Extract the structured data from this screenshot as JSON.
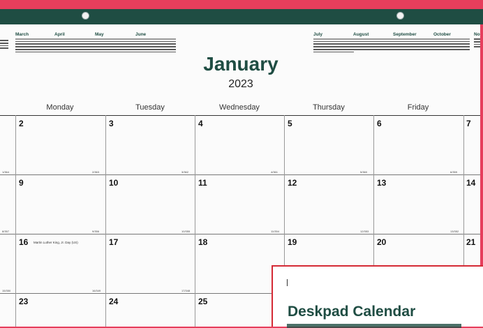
{
  "calendar": {
    "month": "January",
    "year": "2023",
    "mini_left": [
      "March",
      "April",
      "May",
      "June"
    ],
    "mini_right": [
      "July",
      "August",
      "September",
      "October",
      "No"
    ],
    "weekdays": [
      "Monday",
      "Tuesday",
      "Wednesday",
      "Thursday",
      "Friday"
    ],
    "week1": [
      "2",
      "3",
      "4",
      "5",
      "6",
      "7"
    ],
    "week2": [
      "9",
      "10",
      "11",
      "12",
      "13",
      "14"
    ],
    "week3": [
      "16",
      "17",
      "18",
      "19",
      "20",
      "21"
    ],
    "week4": [
      "23",
      "24",
      "25"
    ],
    "holiday": "Martin Luther King, Jr. Day (US)",
    "counters": {
      "c1": "1/364",
      "c2": "2/363",
      "c3": "3/362",
      "c4": "4/361",
      "c5": "5/360",
      "c6": "6/359",
      "c8": "8/357",
      "c9": "9/356",
      "c10": "10/355",
      "c11": "11/354",
      "c12": "12/353",
      "c13": "13/352",
      "c15": "15/350",
      "c16": "16/349",
      "c17": "17/348"
    }
  },
  "panel": {
    "title": "Deskpad Calendar"
  },
  "colors": {
    "background": "#e63e5c",
    "header_strip": "#1f4d43",
    "accent_green": "#1f4d43",
    "panel_border": "#d42a35"
  }
}
